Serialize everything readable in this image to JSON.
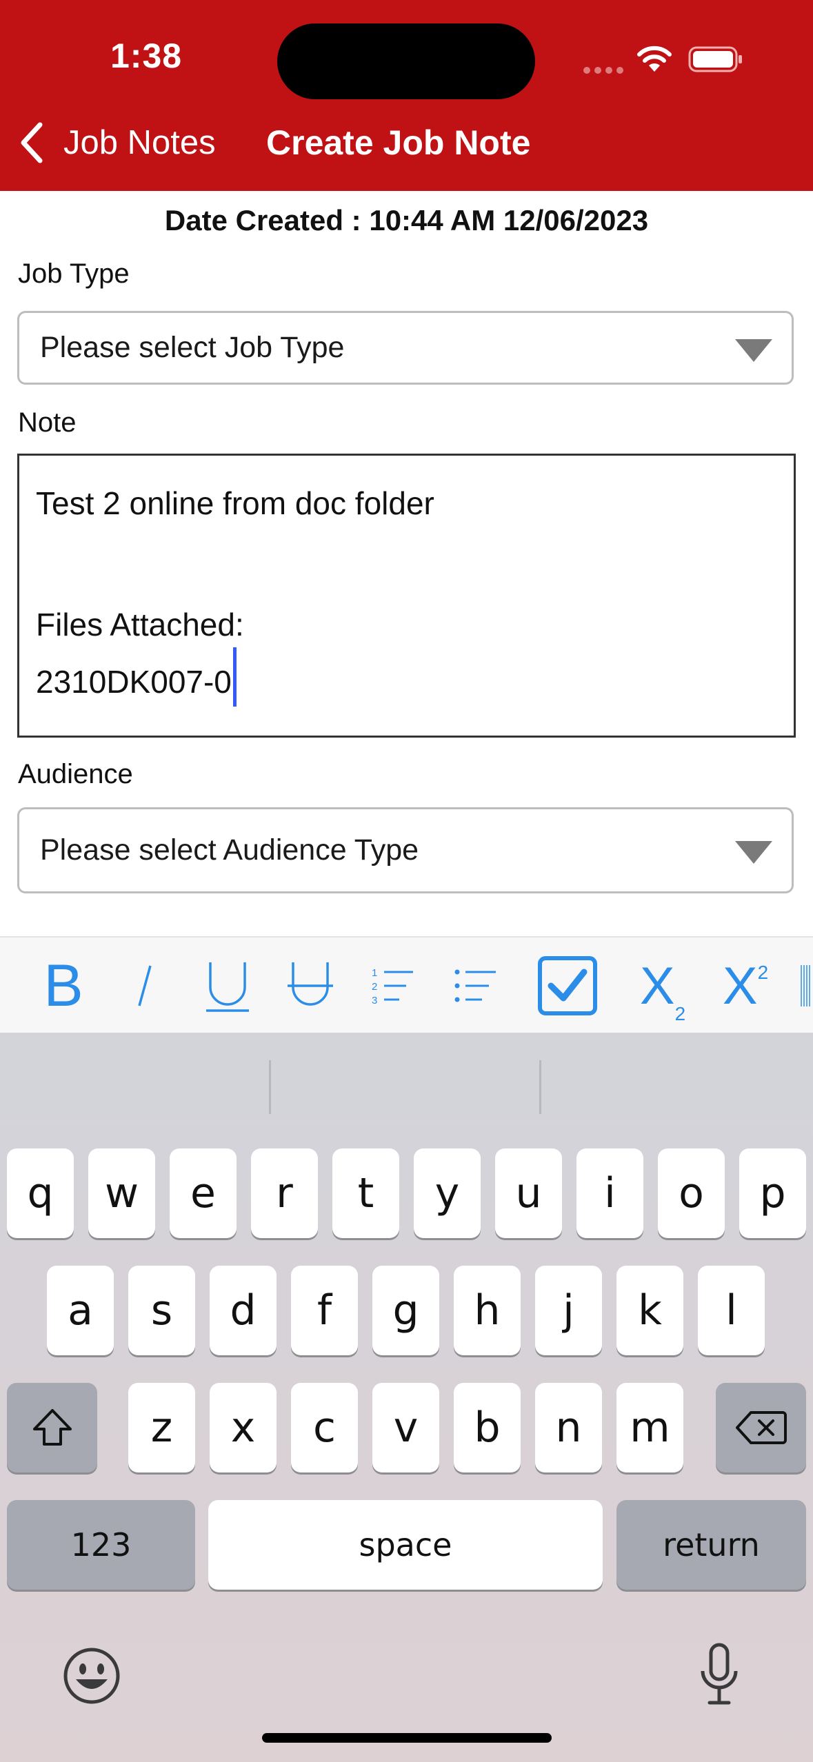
{
  "status_bar": {
    "time": "1:38"
  },
  "nav": {
    "back_label": "Job Notes",
    "title": "Create Job Note"
  },
  "form": {
    "date_created": "Date Created : 10:44 AM 12/06/2023",
    "job_type": {
      "label": "Job Type",
      "placeholder": "Please select Job Type"
    },
    "note": {
      "label": "Note",
      "lines": [
        "Test 2 online from doc folder",
        "Files Attached:",
        "2310DK007-0"
      ]
    },
    "audience": {
      "label": "Audience",
      "placeholder": "Please select Audience Type"
    }
  },
  "toolbar": {
    "buttons": [
      {
        "name": "bold",
        "icon": "bold-icon",
        "glyph": "B"
      },
      {
        "name": "italic",
        "icon": "italic-icon",
        "glyph": "/"
      },
      {
        "name": "underline",
        "icon": "underline-icon",
        "glyph": "U"
      },
      {
        "name": "strikethrough",
        "icon": "strikethrough-icon",
        "glyph": "U"
      },
      {
        "name": "ordered-list",
        "icon": "ordered-list-icon"
      },
      {
        "name": "unordered-list",
        "icon": "unordered-list-icon"
      },
      {
        "name": "checkbox",
        "icon": "checkbox-icon"
      },
      {
        "name": "subscript",
        "icon": "subscript-icon",
        "glyph": "X",
        "script": "2"
      },
      {
        "name": "superscript",
        "icon": "superscript-icon",
        "glyph": "X",
        "script": "2"
      }
    ],
    "accent": "#2b8de8"
  },
  "keyboard": {
    "row1": [
      "q",
      "w",
      "e",
      "r",
      "t",
      "y",
      "u",
      "i",
      "o",
      "p"
    ],
    "row2": [
      "a",
      "s",
      "d",
      "f",
      "g",
      "h",
      "j",
      "k",
      "l"
    ],
    "row3": [
      "z",
      "x",
      "c",
      "v",
      "b",
      "n",
      "m"
    ],
    "numbers_label": "123",
    "space_label": "space",
    "return_label": "return"
  },
  "colors": {
    "header": "#c01214",
    "caret": "#2f5bff"
  }
}
